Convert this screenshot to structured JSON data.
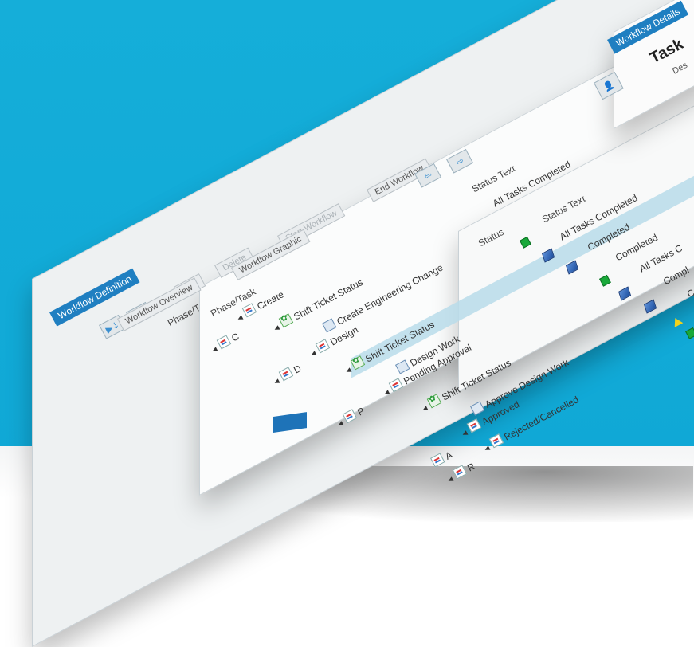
{
  "panels": {
    "definition_tab": "Workflow Definition",
    "details_tab": "Workflow Details",
    "details_title": "Task",
    "details_subtitle": "Des"
  },
  "toolbar": {
    "add": "Add",
    "delete": "Delete",
    "start_workflow": "Start Workflow",
    "end_workflow": "End Workflow",
    "overview_tab": "Workflow Overview",
    "graphic_tab": "Workflow Graphic"
  },
  "tree": {
    "header": "Phase/Task",
    "back_header": "Phase/T",
    "items": [
      {
        "label": "Create"
      },
      {
        "label": "Shift Ticket Status"
      },
      {
        "label": "Create Engineering Change"
      },
      {
        "label": "Design"
      },
      {
        "label": "Shift Ticket Status"
      },
      {
        "label": "Design Work"
      },
      {
        "label": "Pending Approval"
      },
      {
        "label": "Shift Ticket Status"
      },
      {
        "label": "Approve Design Work"
      },
      {
        "label": "Approved"
      },
      {
        "label": "Rejected/Cancelled"
      }
    ],
    "back_fragments": [
      "C",
      "D",
      "P",
      "A",
      "R"
    ]
  },
  "status": {
    "header": "Status",
    "text_header": "Status Text",
    "back_text_header": "Status Text",
    "back_first": "All Tasks Completed",
    "texts": [
      "All Tasks Completed",
      "Completed",
      "Completed",
      "All Tasks C",
      "Compl",
      "C"
    ]
  },
  "colors": {
    "background": "#12abd8",
    "tab_blue": "#1f7fc1",
    "highlight": "#b8dcea",
    "status_green": "#19a93a",
    "status_cube": "#2f6fc4",
    "status_warning": "#f2d21a"
  },
  "icons": {
    "move_down": "move-down-icon",
    "move_up": "move-up-icon",
    "user_settings": "user-settings-icon",
    "nav_arrows": "arrow-icon"
  }
}
